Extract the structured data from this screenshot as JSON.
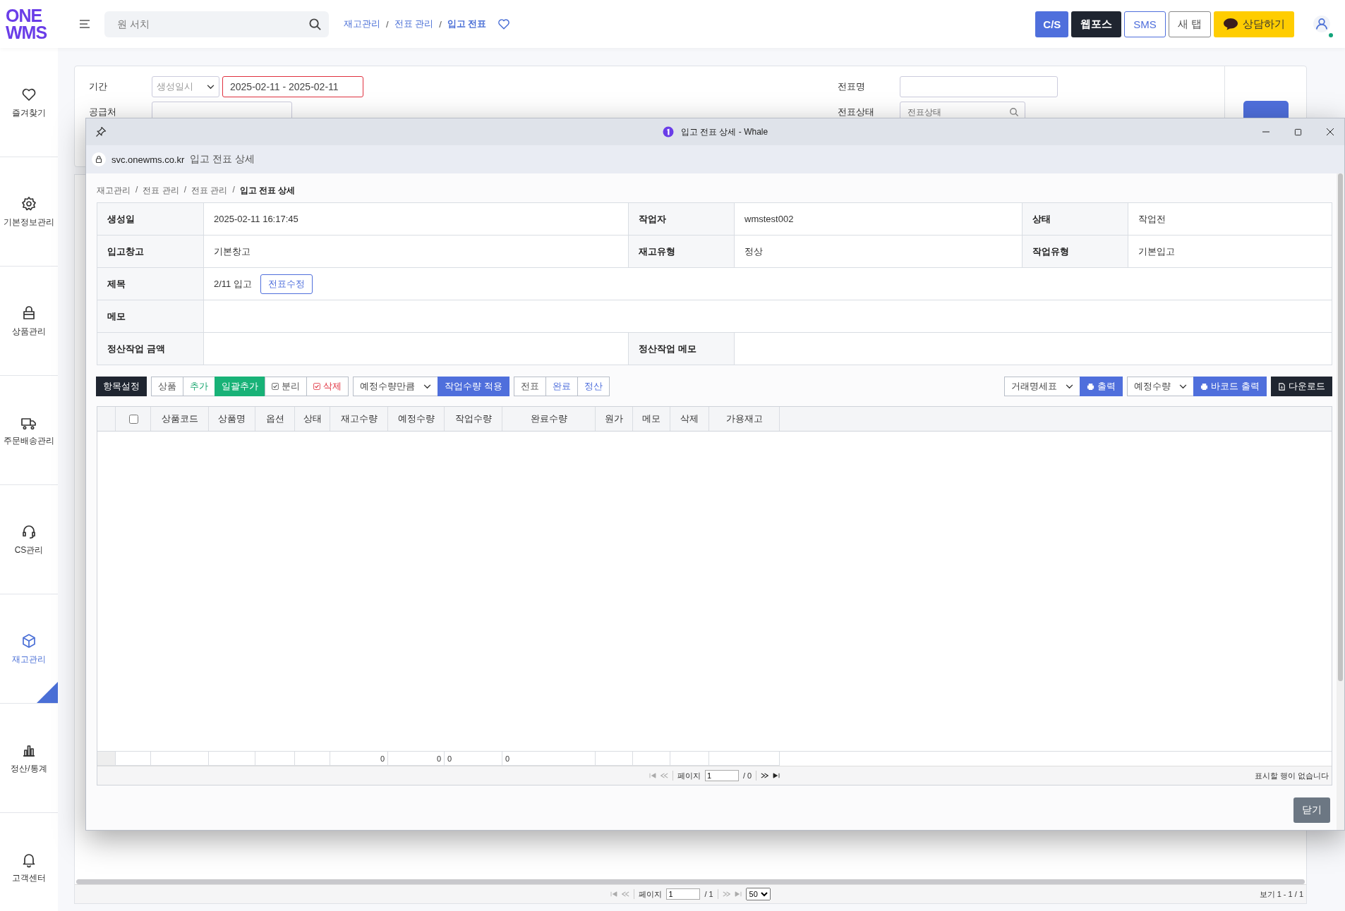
{
  "header": {
    "logo_top": "ONE",
    "logo_bottom": "WMS",
    "search": {
      "placeholder": "원 서치"
    },
    "breadcrumb_separator": "/",
    "breadcrumbs": [
      {
        "label": "재고관리",
        "current": false
      },
      {
        "label": "전표 관리",
        "current": false
      },
      {
        "label": "입고 전표",
        "current": true
      }
    ],
    "buttons": [
      {
        "label": "C/S",
        "kind": "primary"
      },
      {
        "label": "웹포스",
        "kind": "dark"
      },
      {
        "label": "SMS",
        "kind": "outline-blue"
      },
      {
        "label": "새 탭",
        "kind": "outline"
      },
      {
        "label": "상담하기",
        "kind": "talk"
      }
    ]
  },
  "sidebar": {
    "items": [
      {
        "label": "즐겨찾기",
        "selected": false
      },
      {
        "label": "기본정보관리",
        "selected": false
      },
      {
        "label": "상품관리",
        "selected": false
      },
      {
        "label": "주문배송관리",
        "selected": false
      },
      {
        "label": "CS관리",
        "selected": false
      },
      {
        "label": "재고관리",
        "selected": true
      },
      {
        "label": "정산/통계",
        "selected": false
      },
      {
        "label": "고객센터",
        "selected": false
      }
    ]
  },
  "filter": {
    "period_label": "기간",
    "period_select": "생성일시",
    "period_value": "2025-02-11 - 2025-02-11",
    "supplier_label": "공급처",
    "slip_name_label": "전표명",
    "slip_status_label": "전표상태",
    "slip_status_placeholder": "전표상태"
  },
  "list_pager": {
    "page_label": "페이지",
    "page": "1",
    "total": "/ 1",
    "page_size": "50",
    "summary": "보기 1 - 1 / 1"
  },
  "popup": {
    "title": "입고 전표 상세 - Whale",
    "address": {
      "domain": "svc.onewms.co.kr",
      "page": "입고 전표 상세"
    },
    "breadcrumb_separator": "/",
    "breadcrumbs": [
      {
        "label": "재고관리",
        "current": false
      },
      {
        "label": "전표 관리",
        "current": false
      },
      {
        "label": "전표 관리",
        "current": false
      },
      {
        "label": "입고 전표 상세",
        "current": true
      }
    ],
    "info_rows": [
      {
        "cells": [
          {
            "label": "생성일",
            "value": "2025-02-11 16:17:45"
          },
          {
            "label": "작업자",
            "value": "wmstest002"
          },
          {
            "label": "상태",
            "value": "작업전"
          }
        ]
      },
      {
        "cells": [
          {
            "label": "입고창고",
            "value": "기본창고"
          },
          {
            "label": "재고유형",
            "value": "정상"
          },
          {
            "label": "작업유형",
            "value": "기본입고"
          }
        ]
      },
      {
        "cells": [
          {
            "label": "제목",
            "value": "2/11 입고",
            "button": "전표수정"
          }
        ]
      },
      {
        "cells": [
          {
            "label": "메모"
          }
        ]
      },
      {
        "cells": [
          {
            "label": "정산작업 금액"
          },
          {
            "label": "정산작업 메모"
          }
        ]
      }
    ],
    "toolbar_left": [
      [
        {
          "label": "항목설정",
          "kind": "dark"
        }
      ],
      [
        {
          "label": "상품",
          "kind": "plain"
        },
        {
          "label": "추가",
          "kind": "green-text"
        },
        {
          "label": "일괄추가",
          "kind": "green"
        },
        {
          "label": "분리",
          "kind": "check"
        },
        {
          "label": "삭제",
          "kind": "check-red"
        }
      ],
      [
        {
          "label": "예정수량만큼",
          "kind": "select"
        },
        {
          "label": "작업수량 적용",
          "kind": "blue"
        }
      ],
      [
        {
          "label": "전표",
          "kind": "plain"
        },
        {
          "label": "완료",
          "kind": "outline-blue"
        },
        {
          "label": "정산",
          "kind": "outline-blue"
        }
      ]
    ],
    "toolbar_right": [
      [
        {
          "label": "거래명세표",
          "kind": "select"
        },
        {
          "label": "출력",
          "kind": "print"
        }
      ],
      [
        {
          "label": "예정수량",
          "kind": "select"
        },
        {
          "label": "바코드 출력",
          "kind": "print"
        }
      ],
      [
        {
          "label": "다운로드",
          "kind": "download"
        }
      ]
    ],
    "grid": {
      "columns": [
        {
          "label": "상품코드"
        },
        {
          "label": "상품명"
        },
        {
          "label": "옵션"
        },
        {
          "label": "상태"
        },
        {
          "label": "재고수량",
          "total": "0"
        },
        {
          "label": "예정수량",
          "total": "0"
        },
        {
          "label": "작업수량",
          "total": "0"
        },
        {
          "label": "완료수량",
          "total": "0"
        },
        {
          "label": "원가"
        },
        {
          "label": "메모"
        },
        {
          "label": "삭제"
        },
        {
          "label": "가용재고"
        }
      ],
      "all_checked": false,
      "pager": {
        "page_label": "페이지",
        "page": "1",
        "total": "/ 0"
      },
      "empty_message": "표시할 행이 없습니다"
    },
    "close_button": "닫기"
  }
}
